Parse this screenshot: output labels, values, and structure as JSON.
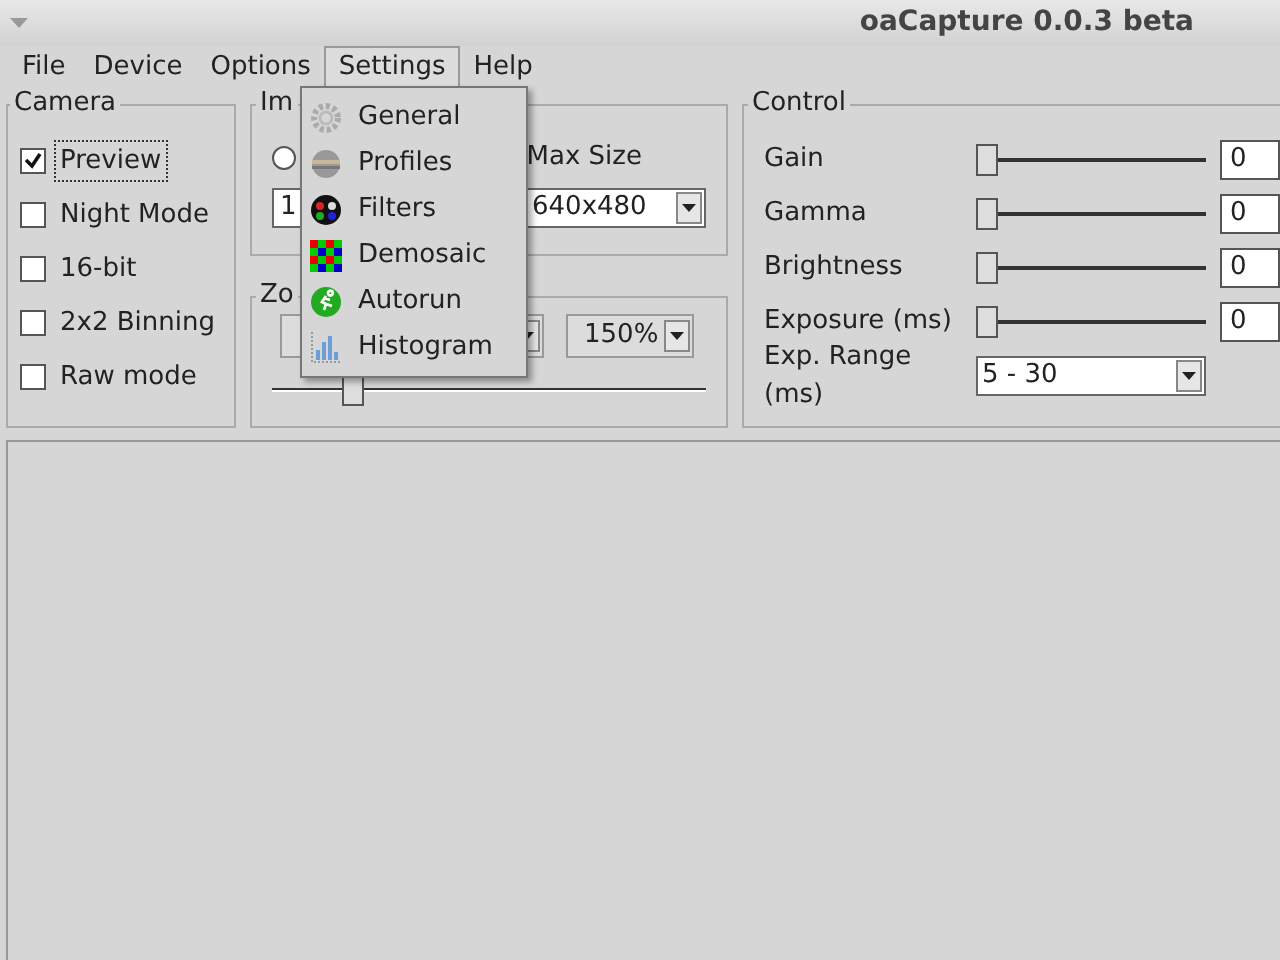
{
  "window": {
    "title": "oaCapture 0.0.3 beta"
  },
  "menu_bar": [
    {
      "label": "File",
      "selected": false
    },
    {
      "label": "Device",
      "selected": false
    },
    {
      "label": "Options",
      "selected": false
    },
    {
      "label": "Settings",
      "selected": true
    },
    {
      "label": "Help",
      "selected": false
    }
  ],
  "settings_menu": [
    {
      "label": "General"
    },
    {
      "label": "Profiles"
    },
    {
      "label": "Filters"
    },
    {
      "label": "Demosaic"
    },
    {
      "label": "Autorun"
    },
    {
      "label": "Histogram"
    }
  ],
  "camera": {
    "title": "Camera",
    "options": [
      {
        "label": "Preview",
        "checked": true,
        "focused": true
      },
      {
        "label": "Night Mode",
        "checked": false,
        "focused": false
      },
      {
        "label": "16-bit",
        "checked": false,
        "focused": false
      },
      {
        "label": "2x2 Binning",
        "checked": false,
        "focused": false
      },
      {
        "label": "Raw mode",
        "checked": false,
        "focused": false
      }
    ]
  },
  "image": {
    "title": "Im",
    "radio_selected": false,
    "max_size_label": "Max Size",
    "size_combo": "1",
    "resolution_combo": "640x480"
  },
  "zoom": {
    "title": "Zo",
    "zoom_combo": "150%",
    "level": 0.17
  },
  "control": {
    "title": "Control",
    "sliders": [
      {
        "label": "Gain",
        "level": 0,
        "value": "0"
      },
      {
        "label": "Gamma",
        "level": 0,
        "value": "0"
      },
      {
        "label": "Brightness",
        "level": 0,
        "value": "0"
      },
      {
        "label": "Exposure (ms)",
        "level": 0,
        "value": "0"
      }
    ],
    "exp_range": {
      "label": "Exp. Range (ms)",
      "value": "5 - 30"
    }
  }
}
